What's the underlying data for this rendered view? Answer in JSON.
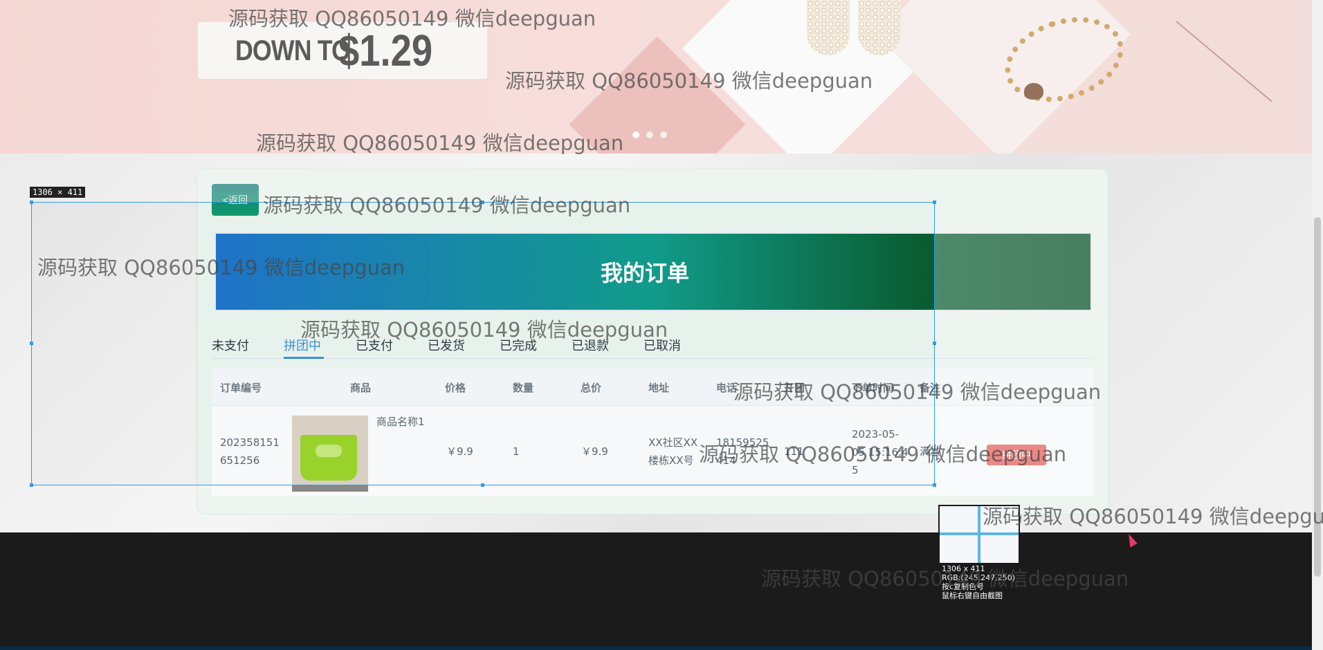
{
  "banner": {
    "promo_text": "DOWN TO",
    "promo_price": "$1.29",
    "carousel_dots": 3
  },
  "back_button": {
    "label": "<返回"
  },
  "header": {
    "title": "我的订单"
  },
  "tabs": [
    {
      "label": "未支付"
    },
    {
      "label": "拼团中"
    },
    {
      "label": "已支付"
    },
    {
      "label": "已发货"
    },
    {
      "label": "已完成"
    },
    {
      "label": "已退款"
    },
    {
      "label": "已取消"
    }
  ],
  "active_tab": "拼团中",
  "table": {
    "columns": [
      "订单编号",
      "商品",
      "价格",
      "数量",
      "总价",
      "地址",
      "电话",
      "开团",
      "下单时间",
      "备注"
    ],
    "rows": [
      {
        "order_no_line1": "202358151",
        "order_no_line2": "651256",
        "product_name": "商品名称1",
        "price": "￥9.9",
        "quantity": "1",
        "total": "￥9.9",
        "address_line1": "XX社区XX",
        "address_line2": "楼栋XX号",
        "phone_line1": "18159525",
        "phone_line2": "414",
        "group": "111",
        "time_line1": "2023-05-",
        "time_line2": "05 15:16:4",
        "time_line3": "5",
        "remark": "满减",
        "status": "拼团中"
      }
    ]
  },
  "selection": {
    "size_label": "1306 × 411"
  },
  "magnifier": {
    "size": "1306 x 411",
    "rgb": "RGB:(245,247,250)",
    "hint_copy": "按c复制色号",
    "hint_free": "鼠标右键自由截图"
  },
  "watermark": "源码获取 QQ86050149 微信deepguan",
  "colors": {
    "accent_blue": "#3a8fd8",
    "header_gradient_start": "#1f73c8",
    "header_gradient_end": "#034e24",
    "selection_border": "#2f9be6",
    "status_red": "#e55a56"
  }
}
